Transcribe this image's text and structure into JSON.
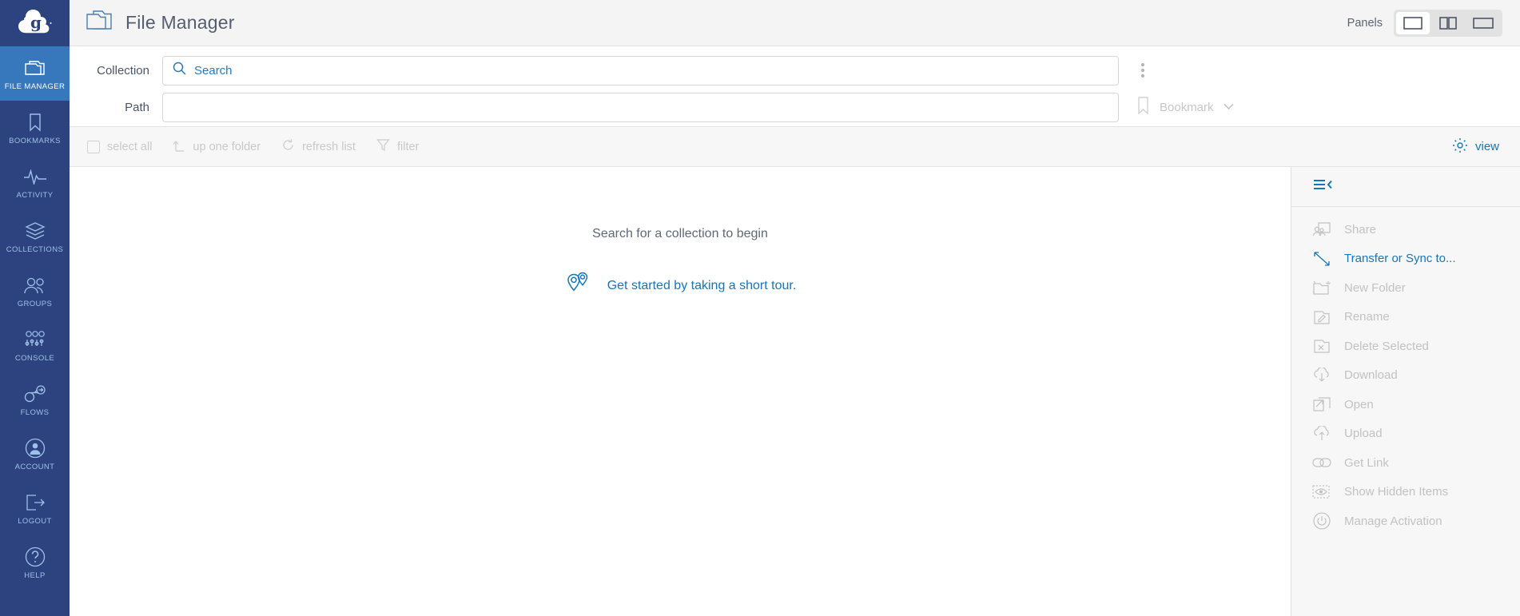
{
  "brand": {
    "logo_name": "globus-logo",
    "navy": "#2c4380",
    "active_blue": "#3778bd",
    "link_blue": "#1576b8"
  },
  "header": {
    "title": "File Manager",
    "folder_icon": "folder-icon",
    "panels_label": "Panels",
    "panel_buttons": [
      {
        "name": "panel-single",
        "icon": "single-panel-icon",
        "selected": true
      },
      {
        "name": "panel-split",
        "icon": "two-panel-icon",
        "selected": false
      },
      {
        "name": "panel-wide",
        "icon": "wide-panel-icon",
        "selected": false
      }
    ]
  },
  "sidebar": {
    "items": [
      {
        "label": "FILE MANAGER",
        "icon": "folder-icon",
        "active": true
      },
      {
        "label": "BOOKMARKS",
        "icon": "bookmark-icon",
        "active": false
      },
      {
        "label": "ACTIVITY",
        "icon": "pulse-icon",
        "active": false
      },
      {
        "label": "COLLECTIONS",
        "icon": "layers-icon",
        "active": false
      },
      {
        "label": "GROUPS",
        "icon": "people-icon",
        "active": false
      },
      {
        "label": "CONSOLE",
        "icon": "sliders-icon",
        "active": false
      },
      {
        "label": "FLOWS",
        "icon": "flow-icon",
        "active": false
      },
      {
        "label": "ACCOUNT",
        "icon": "account-circle-icon",
        "active": false
      },
      {
        "label": "LOGOUT",
        "icon": "logout-icon",
        "active": false
      },
      {
        "label": "HELP",
        "icon": "question-circle-icon",
        "active": false
      }
    ]
  },
  "search": {
    "collection_label": "Collection",
    "collection_placeholder": "Search",
    "collection_value": "",
    "search_icon": "search-icon",
    "path_label": "Path",
    "path_placeholder": "",
    "path_value": "",
    "kebab_icon": "more-vertical-icon",
    "bookmark_icon": "bookmark-icon",
    "bookmark_label": "Bookmark",
    "bookmark_chevron": "chevron-down-icon"
  },
  "toolbar": {
    "items": [
      {
        "label": "select all",
        "icon": "checkbox-icon"
      },
      {
        "label": "up one folder",
        "icon": "arrow-up-icon"
      },
      {
        "label": "refresh list",
        "icon": "refresh-icon"
      },
      {
        "label": "filter",
        "icon": "funnel-icon"
      }
    ],
    "view_label": "view",
    "view_icon": "gear-icon"
  },
  "content": {
    "empty_message": "Search for a collection to begin",
    "tour_link": "Get started by taking a short tour.",
    "tour_icon": "map-pins-icon"
  },
  "right_panel": {
    "collapse_icon": "collapse-panel-icon",
    "items": [
      {
        "label": "Share",
        "icon": "share-folder-icon",
        "enabled": false
      },
      {
        "label": "Transfer or Sync to...",
        "icon": "transfer-arrows-icon",
        "enabled": true
      },
      {
        "label": "New Folder",
        "icon": "new-folder-icon",
        "enabled": false
      },
      {
        "label": "Rename",
        "icon": "rename-pencil-icon",
        "enabled": false
      },
      {
        "label": "Delete Selected",
        "icon": "delete-x-icon",
        "enabled": false
      },
      {
        "label": "Download",
        "icon": "cloud-download-icon",
        "enabled": false
      },
      {
        "label": "Open",
        "icon": "open-external-icon",
        "enabled": false
      },
      {
        "label": "Upload",
        "icon": "cloud-upload-icon",
        "enabled": false
      },
      {
        "label": "Get Link",
        "icon": "link-chain-icon",
        "enabled": false
      },
      {
        "label": "Show Hidden Items",
        "icon": "eye-icon",
        "enabled": false
      },
      {
        "label": "Manage Activation",
        "icon": "power-icon",
        "enabled": false
      }
    ]
  }
}
